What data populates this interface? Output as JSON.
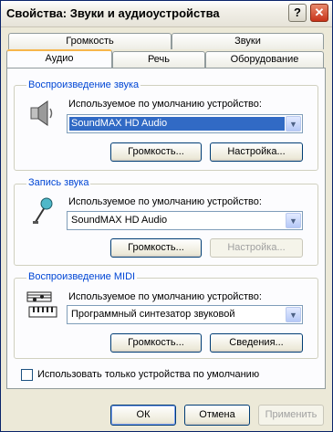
{
  "window": {
    "title": "Свойства: Звуки и аудиоустройства",
    "help_glyph": "?",
    "close_glyph": "✕"
  },
  "tabs": {
    "row_back": [
      {
        "label": "Громкость"
      },
      {
        "label": "Звуки"
      }
    ],
    "row_front": [
      {
        "label": "Аудио",
        "selected": true
      },
      {
        "label": "Речь"
      },
      {
        "label": "Оборудование"
      }
    ]
  },
  "playback": {
    "title": "Воспроизведение звука",
    "default_label": "Используемое по умолчанию устройство:",
    "device": "SoundMAX HD Audio",
    "volume_button": "Громкость...",
    "settings_button": "Настройка..."
  },
  "recording": {
    "title": "Запись звука",
    "default_label": "Используемое по умолчанию устройство:",
    "device": "SoundMAX HD Audio",
    "volume_button": "Громкость...",
    "settings_button": "Настройка..."
  },
  "midi": {
    "title": "Воспроизведение MIDI",
    "default_label": "Используемое по умолчанию устройство:",
    "device": "Программный синтезатор звуковой",
    "volume_button": "Громкость...",
    "info_button": "Сведения..."
  },
  "use_only_default": {
    "label": "Использовать только устройства по умолчанию",
    "checked": false
  },
  "footer": {
    "ok": "ОК",
    "cancel": "Отмена",
    "apply": "Применить"
  },
  "colors": {
    "group_title": "#0046d5",
    "selection": "#316ac5",
    "tab_highlight": "#f7b64b"
  }
}
